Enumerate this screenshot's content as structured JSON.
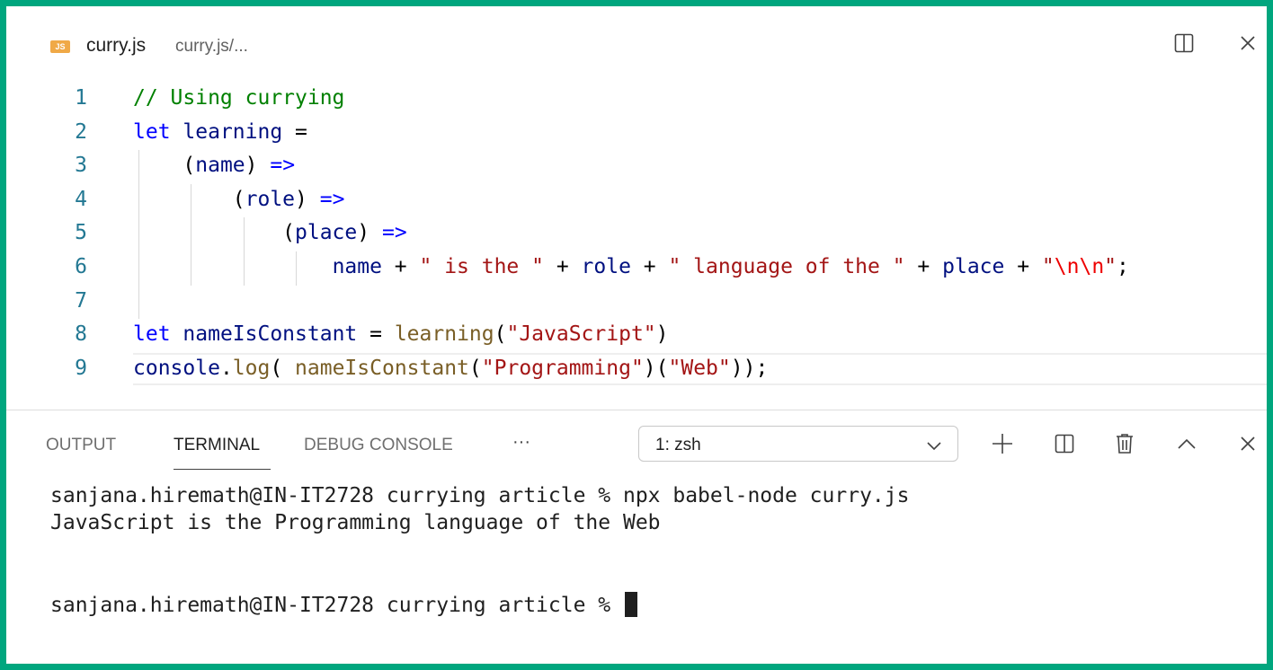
{
  "editor": {
    "icon_text": "JS",
    "file_name": "curry.js",
    "file_path": "curry.js/..."
  },
  "code": {
    "lines": [
      {
        "number": "1",
        "tokens": [
          {
            "text": "// Using currying",
            "type": "comment"
          }
        ]
      },
      {
        "number": "2",
        "tokens": [
          {
            "text": "let",
            "type": "keyword"
          },
          {
            "text": " ",
            "type": "op"
          },
          {
            "text": "learning",
            "type": "var"
          },
          {
            "text": " =",
            "type": "op"
          }
        ]
      },
      {
        "number": "3",
        "tokens": [
          {
            "text": "    (",
            "type": "op"
          },
          {
            "text": "name",
            "type": "var"
          },
          {
            "text": ") ",
            "type": "op"
          },
          {
            "text": "=>",
            "type": "keyword"
          }
        ]
      },
      {
        "number": "4",
        "tokens": [
          {
            "text": "        (",
            "type": "op"
          },
          {
            "text": "role",
            "type": "var"
          },
          {
            "text": ") ",
            "type": "op"
          },
          {
            "text": "=>",
            "type": "keyword"
          }
        ]
      },
      {
        "number": "5",
        "tokens": [
          {
            "text": "            (",
            "type": "op"
          },
          {
            "text": "place",
            "type": "var"
          },
          {
            "text": ") ",
            "type": "op"
          },
          {
            "text": "=>",
            "type": "keyword"
          }
        ]
      },
      {
        "number": "6",
        "tokens": [
          {
            "text": "                ",
            "type": "op"
          },
          {
            "text": "name",
            "type": "var"
          },
          {
            "text": " + ",
            "type": "op"
          },
          {
            "text": "\" is the \"",
            "type": "str"
          },
          {
            "text": " + ",
            "type": "op"
          },
          {
            "text": "role",
            "type": "var"
          },
          {
            "text": " + ",
            "type": "op"
          },
          {
            "text": "\" language of the \"",
            "type": "str"
          },
          {
            "text": " + ",
            "type": "op"
          },
          {
            "text": "place",
            "type": "var"
          },
          {
            "text": " + ",
            "type": "op"
          },
          {
            "text": "\"",
            "type": "str"
          },
          {
            "text": "\\n\\n",
            "type": "esc"
          },
          {
            "text": "\"",
            "type": "str"
          },
          {
            "text": ";",
            "type": "op"
          }
        ]
      },
      {
        "number": "7",
        "tokens": []
      },
      {
        "number": "8",
        "tokens": [
          {
            "text": "let",
            "type": "keyword"
          },
          {
            "text": " ",
            "type": "op"
          },
          {
            "text": "nameIsConstant",
            "type": "var"
          },
          {
            "text": " = ",
            "type": "op"
          },
          {
            "text": "learning",
            "type": "func"
          },
          {
            "text": "(",
            "type": "op"
          },
          {
            "text": "\"JavaScript\"",
            "type": "str"
          },
          {
            "text": ")",
            "type": "op"
          }
        ]
      },
      {
        "number": "9",
        "tokens": [
          {
            "text": "console",
            "type": "var"
          },
          {
            "text": ".",
            "type": "op"
          },
          {
            "text": "log",
            "type": "func"
          },
          {
            "text": "( ",
            "type": "op"
          },
          {
            "text": "nameIsConstant",
            "type": "func"
          },
          {
            "text": "(",
            "type": "op"
          },
          {
            "text": "\"Programming\"",
            "type": "str"
          },
          {
            "text": ")(",
            "type": "op"
          },
          {
            "text": "\"Web\"",
            "type": "str"
          },
          {
            "text": "));",
            "type": "op"
          }
        ]
      }
    ]
  },
  "panel": {
    "tabs": [
      "OUTPUT",
      "TERMINAL",
      "DEBUG CONSOLE"
    ],
    "active_tab": "TERMINAL",
    "more_label": "···",
    "terminal_select": "1: zsh"
  },
  "terminal": {
    "lines": [
      "sanjana.hiremath@IN-IT2728 currying article % npx babel-node curry.js",
      "JavaScript is the Programming language of the Web",
      "",
      "",
      "sanjana.hiremath@IN-IT2728 currying article % "
    ]
  },
  "colors": {
    "frame_border": "#00a67e",
    "js_icon": "#f0a947",
    "comment": "#008000",
    "keyword": "#0000ff",
    "variable": "#001080",
    "function": "#795e26",
    "string": "#a31515",
    "escape": "#ee0000",
    "line_number": "#237893"
  },
  "icons": {
    "split_editor": "split-editor-icon",
    "close_editor": "close-icon",
    "chevron": "chevron-down-icon",
    "add_terminal": "plus-icon",
    "split_terminal": "split-terminal-icon",
    "kill_terminal": "trash-icon",
    "maximize_panel": "chevron-up-icon",
    "close_panel": "close-icon"
  }
}
